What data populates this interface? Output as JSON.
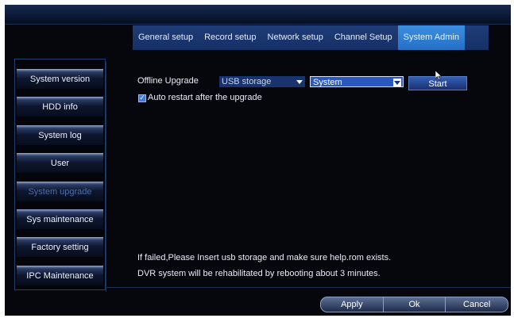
{
  "tabs": [
    {
      "label": "General setup",
      "active": false
    },
    {
      "label": "Record setup",
      "active": false
    },
    {
      "label": "Network setup",
      "active": false
    },
    {
      "label": "Channel Setup",
      "active": false
    },
    {
      "label": "System Admin",
      "active": true
    }
  ],
  "sidebar": {
    "items": [
      {
        "label": "System version",
        "active": false
      },
      {
        "label": "HDD info",
        "active": false
      },
      {
        "label": "System log",
        "active": false
      },
      {
        "label": "User",
        "active": false
      },
      {
        "label": "System upgrade",
        "active": true
      },
      {
        "label": "Sys maintenance",
        "active": false
      },
      {
        "label": "Factory setting",
        "active": false
      },
      {
        "label": "IPC Maintenance",
        "active": false
      }
    ]
  },
  "upgrade": {
    "label": "Offline Upgrade",
    "source_select": "USB storage",
    "target_select": "System",
    "start_button": "Start",
    "auto_restart_label": "Auto restart after the upgrade",
    "auto_restart_checked": true
  },
  "notes": {
    "line1": "If failed,Please Insert usb storage and make sure help.rom exists.",
    "line2": "DVR system will be rehabilitated by rebooting about 3 minutes."
  },
  "footer": {
    "apply": "Apply",
    "ok": "Ok",
    "cancel": "Cancel"
  },
  "colors": {
    "background": "#05070d",
    "tab_bar": "#163067",
    "tab_active": "#2470c6",
    "sidebar_active_text": "#4f6da8"
  },
  "icons": [
    "mouse-cursor-icon",
    "checkmark-icon",
    "dropdown-arrow-icon"
  ]
}
